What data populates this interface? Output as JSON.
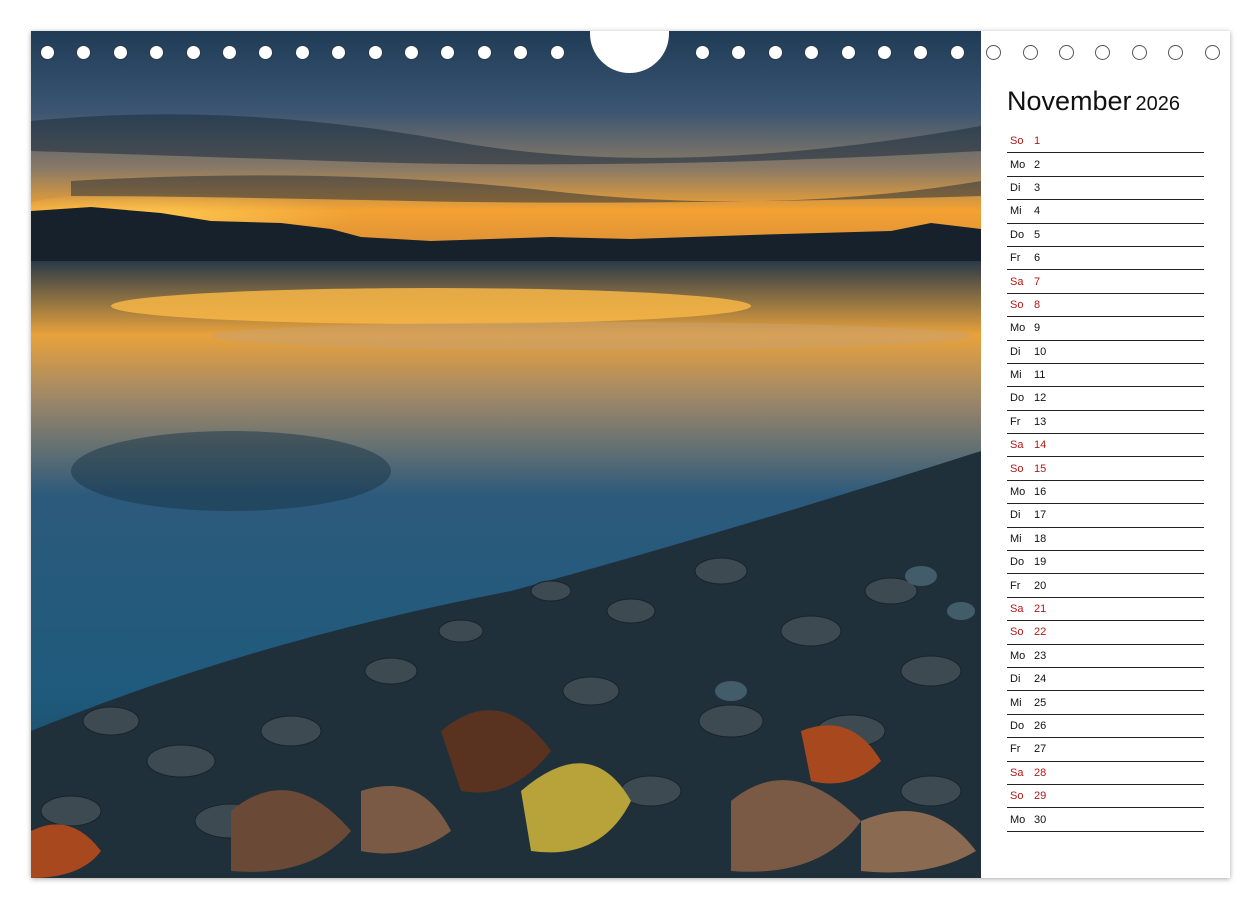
{
  "calendar": {
    "month": "November",
    "year": "2026",
    "days": [
      {
        "wd": "So",
        "d": "1",
        "red": true
      },
      {
        "wd": "Mo",
        "d": "2",
        "red": false
      },
      {
        "wd": "Di",
        "d": "3",
        "red": false
      },
      {
        "wd": "Mi",
        "d": "4",
        "red": false
      },
      {
        "wd": "Do",
        "d": "5",
        "red": false
      },
      {
        "wd": "Fr",
        "d": "6",
        "red": false
      },
      {
        "wd": "Sa",
        "d": "7",
        "red": true
      },
      {
        "wd": "So",
        "d": "8",
        "red": true
      },
      {
        "wd": "Mo",
        "d": "9",
        "red": false
      },
      {
        "wd": "Di",
        "d": "10",
        "red": false
      },
      {
        "wd": "Mi",
        "d": "11",
        "red": false
      },
      {
        "wd": "Do",
        "d": "12",
        "red": false
      },
      {
        "wd": "Fr",
        "d": "13",
        "red": false
      },
      {
        "wd": "Sa",
        "d": "14",
        "red": true
      },
      {
        "wd": "So",
        "d": "15",
        "red": true
      },
      {
        "wd": "Mo",
        "d": "16",
        "red": false
      },
      {
        "wd": "Di",
        "d": "17",
        "red": false
      },
      {
        "wd": "Mi",
        "d": "18",
        "red": false
      },
      {
        "wd": "Do",
        "d": "19",
        "red": false
      },
      {
        "wd": "Fr",
        "d": "20",
        "red": false
      },
      {
        "wd": "Sa",
        "d": "21",
        "red": true
      },
      {
        "wd": "So",
        "d": "22",
        "red": true
      },
      {
        "wd": "Mo",
        "d": "23",
        "red": false
      },
      {
        "wd": "Di",
        "d": "24",
        "red": false
      },
      {
        "wd": "Mi",
        "d": "25",
        "red": false
      },
      {
        "wd": "Do",
        "d": "26",
        "red": false
      },
      {
        "wd": "Fr",
        "d": "27",
        "red": false
      },
      {
        "wd": "Sa",
        "d": "28",
        "red": true
      },
      {
        "wd": "So",
        "d": "29",
        "red": true
      },
      {
        "wd": "Mo",
        "d": "30",
        "red": false
      }
    ]
  },
  "colors": {
    "weekend": "#b01818",
    "text": "#111111",
    "sky": "#2a4a66",
    "sunset": "#f0a030",
    "water": "#1c4a66"
  }
}
